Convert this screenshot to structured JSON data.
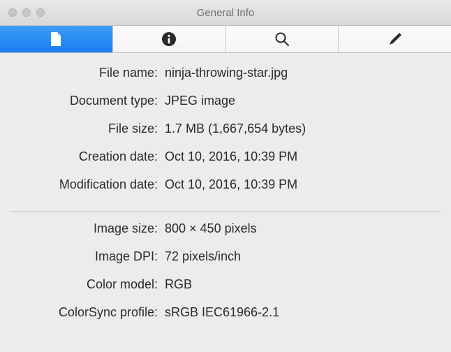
{
  "window": {
    "title": "General Info"
  },
  "tabs": [
    {
      "name": "file-tab",
      "icon": "file-icon",
      "active": true
    },
    {
      "name": "info-tab",
      "icon": "info-icon",
      "active": false
    },
    {
      "name": "search-tab",
      "icon": "search-icon",
      "active": false
    },
    {
      "name": "edit-tab",
      "icon": "pencil-icon",
      "active": false
    }
  ],
  "section1": [
    {
      "label": "File name:",
      "value": "ninja-throwing-star.jpg"
    },
    {
      "label": "Document type:",
      "value": "JPEG image"
    },
    {
      "label": "File size:",
      "value": "1.7 MB (1,667,654 bytes)"
    },
    {
      "label": "Creation date:",
      "value": "Oct 10, 2016, 10:39 PM"
    },
    {
      "label": "Modification date:",
      "value": "Oct 10, 2016, 10:39 PM"
    }
  ],
  "section2": [
    {
      "label": "Image size:",
      "value": "800 × 450 pixels"
    },
    {
      "label": "Image DPI:",
      "value": "72 pixels/inch"
    },
    {
      "label": "Color model:",
      "value": "RGB"
    },
    {
      "label": "ColorSync profile:",
      "value": "sRGB IEC61966-2.1"
    }
  ]
}
